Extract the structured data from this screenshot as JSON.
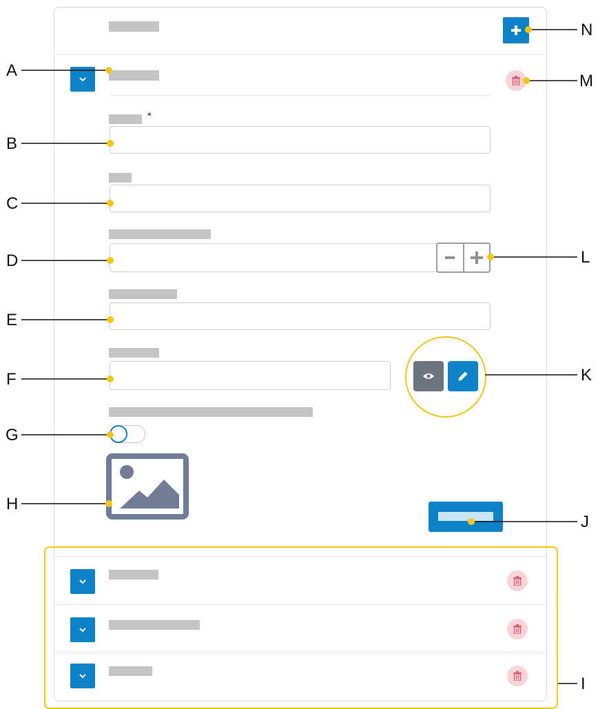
{
  "form": {
    "required_marker": "*"
  },
  "colors": {
    "primary": "#0d82c6",
    "danger_bg": "#f8d4d8",
    "danger_icon": "#e05a6b",
    "secondary": "#6c757d",
    "highlight": "#f5c518",
    "placeholder_bar": "#c4c4c4",
    "image_icon": "#717d96"
  },
  "icons": {
    "add": "plus-icon",
    "expand": "chevron-down-icon",
    "delete": "trash-icon",
    "decrement": "minus-icon",
    "increment": "plus-icon",
    "view": "eye-icon",
    "edit": "pencil-icon",
    "image": "image-icon"
  },
  "callouts": {
    "A": "A",
    "B": "B",
    "C": "C",
    "D": "D",
    "E": "E",
    "F": "F",
    "G": "G",
    "H": "H",
    "I": "I",
    "J": "J",
    "K": "K",
    "L": "L",
    "M": "M",
    "N": "N"
  },
  "toggle": {
    "on": false
  }
}
